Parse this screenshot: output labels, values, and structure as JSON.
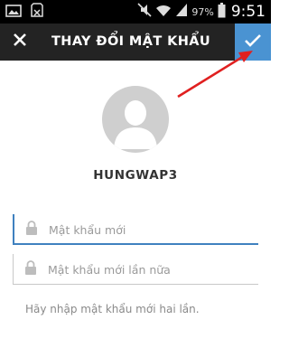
{
  "status_bar": {
    "battery_percent": "97%",
    "time": "9:51",
    "icons": [
      "gallery-icon",
      "sd-card-icon",
      "mute-icon",
      "wifi-icon",
      "signal-icon",
      "battery-icon"
    ]
  },
  "app_bar": {
    "title": "THAY ĐỔI MẬT KHẨU",
    "close_icon": "close-icon",
    "confirm_icon": "checkmark-icon",
    "confirm_color": "#4a93d2"
  },
  "profile": {
    "username": "HUNGWAP3"
  },
  "form": {
    "new_password": {
      "placeholder": "Mật khẩu mới",
      "value": ""
    },
    "confirm_password": {
      "placeholder": "Mật khẩu mới lần nữa",
      "value": ""
    },
    "hint": "Hãy nhập mật khẩu mới hai lần."
  },
  "colors": {
    "toolbar": "#232323",
    "accent": "#3f81bf",
    "annotation_arrow": "#e02020"
  }
}
